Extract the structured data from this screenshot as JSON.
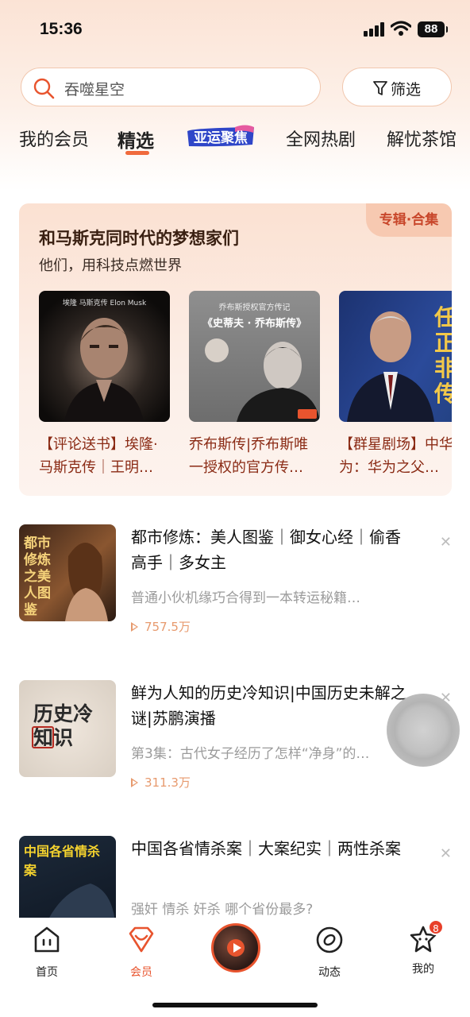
{
  "status_bar": {
    "time": "15:36",
    "battery": "88"
  },
  "search": {
    "placeholder": "吞噬星空",
    "filter_label": "筛选"
  },
  "tabs": [
    {
      "label": "我的会员"
    },
    {
      "label": "精选",
      "active": true
    },
    {
      "label": "亚运聚焦",
      "logo": true
    },
    {
      "label": "全网热剧"
    },
    {
      "label": "解忧茶馆"
    }
  ],
  "feature": {
    "badge": "专辑·合集",
    "title": "和马斯克同时代的梦想家们",
    "subtitle": "他们，用科技点燃世界",
    "books": [
      {
        "caption": "【评论送书】埃隆·马斯克传｜王明…",
        "cover_top": "埃隆  马斯克传  Elon Musk"
      },
      {
        "caption": "乔布斯传|乔布斯唯一授权的官方传…",
        "cover_top": "乔布斯授权官方传记",
        "cover_title": "《史蒂夫 · 乔布斯传》"
      },
      {
        "caption": "【群星剧场】中华有为：华为之父…",
        "cover_top": "任正非传"
      }
    ]
  },
  "list": [
    {
      "title": "都市修炼：美人图鉴｜御女心经｜偷香高手｜多女主",
      "desc": "普通小伙机缘巧合得到一本转运秘籍…",
      "plays": "757.5万",
      "cover_text": "都市修炼之美人图鉴"
    },
    {
      "title": "鲜为人知的历史冷知识|中国历史未解之谜|苏鹏演播",
      "desc": "第3集：古代女子经历了怎样“净身”的…",
      "plays": "311.3万",
      "cover_text": "历史冷知识"
    },
    {
      "title": "中国各省情杀案｜大案纪实｜两性杀案",
      "desc": "强奸 情杀 奸杀 哪个省份最多?",
      "cover_text": "中国各省情杀案"
    }
  ],
  "bottom_nav": [
    {
      "label": "首页",
      "icon": "home-icon"
    },
    {
      "label": "会员",
      "icon": "vip-icon",
      "active": true
    },
    {
      "label": "动态",
      "icon": "discover-icon"
    },
    {
      "label": "我的",
      "icon": "profile-icon",
      "badge": "8"
    }
  ],
  "colors": {
    "accent": "#e8542e",
    "caption": "#8a2a14",
    "muted": "#9b9b9b",
    "plays": "#e79a6e"
  }
}
